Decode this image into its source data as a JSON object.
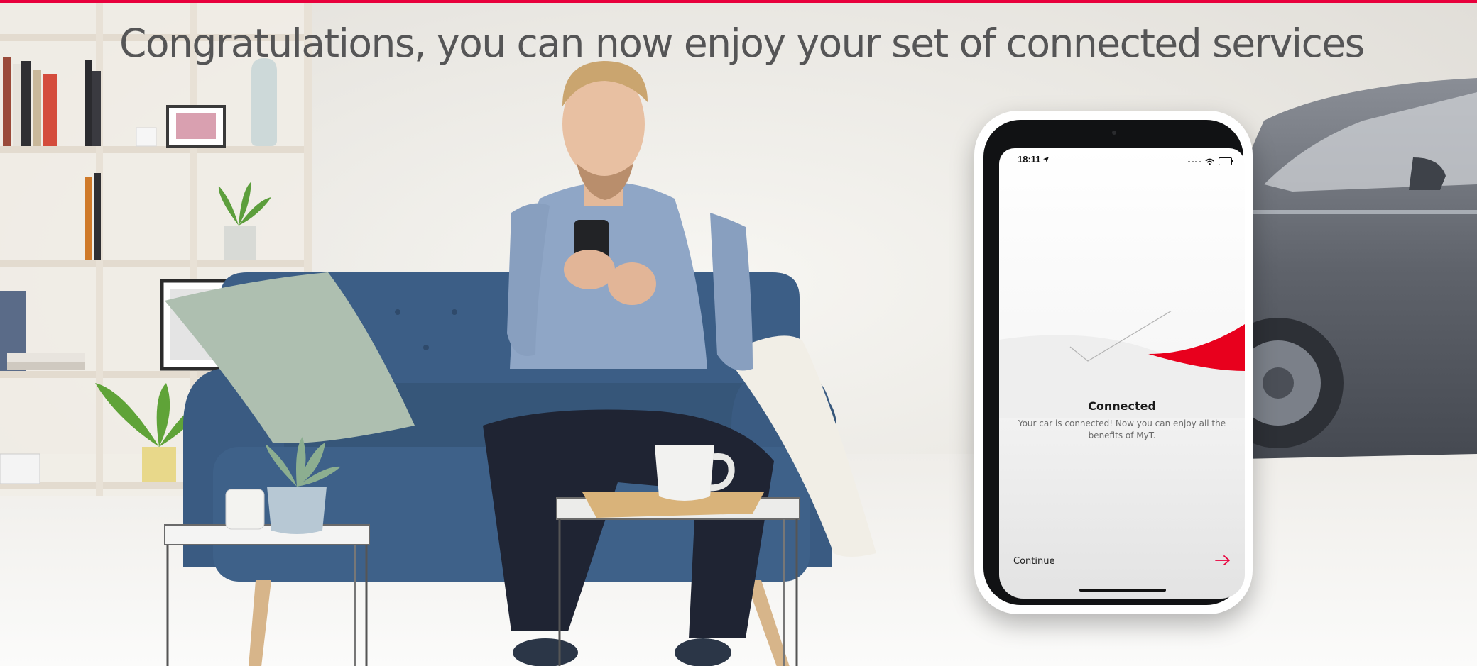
{
  "headline": "Congratulations, you can now enjoy your set of connected services",
  "colors": {
    "accent": "#e8003c",
    "headline": "#555556",
    "sofa": "#3c5e86"
  },
  "phone": {
    "status_time": "18:11",
    "status_icons": [
      "location-arrow-icon",
      "signal-icon",
      "wifi-icon",
      "battery-icon"
    ],
    "title": "Connected",
    "description": "Your car is connected! Now you can enjoy all the benefits of MyT.",
    "continue_label": "Continue",
    "continue_icon": "arrow-right-icon"
  }
}
